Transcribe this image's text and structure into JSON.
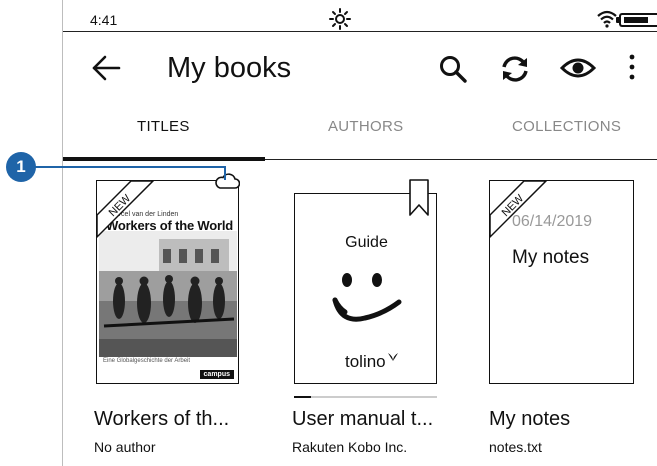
{
  "status_bar": {
    "time": "4:41",
    "battery_level": 0.7
  },
  "header": {
    "title": "My books"
  },
  "tabs": [
    {
      "label": "TITLES",
      "active": true
    },
    {
      "label": "AUTHORS",
      "active": false
    },
    {
      "label": "COLLECTIONS",
      "active": false
    }
  ],
  "books": [
    {
      "name": "Workers of th...",
      "author": "No author",
      "badge": "NEW",
      "in_cloud": true,
      "cover": {
        "author_line": "Marcel van der Linden",
        "title": "Workers of the World",
        "subtitle": "Eine Globalgeschichte der Arbeit",
        "publisher": "campus"
      }
    },
    {
      "name": "User manual t...",
      "author": "Rakuten Kobo Inc.",
      "bookmarked": true,
      "reading_progress": 0.12,
      "cover": {
        "label": "Guide",
        "brand": "tolino"
      }
    },
    {
      "name": "My notes",
      "author": "notes.txt",
      "badge": "NEW",
      "cover": {
        "date": "06/14/2019",
        "title": "My notes"
      }
    }
  ],
  "callout": {
    "number": "1",
    "color": "#1f64a8"
  },
  "icons": {
    "back": "arrow-left-icon",
    "search": "search-icon",
    "sync": "sync-icon",
    "visibility": "eye-icon",
    "more": "more-vertical-icon",
    "light": "brightness-icon",
    "wifi": "wifi-icon",
    "battery": "battery-icon",
    "cloud": "cloud-icon",
    "bookmark": "bookmark-icon"
  }
}
